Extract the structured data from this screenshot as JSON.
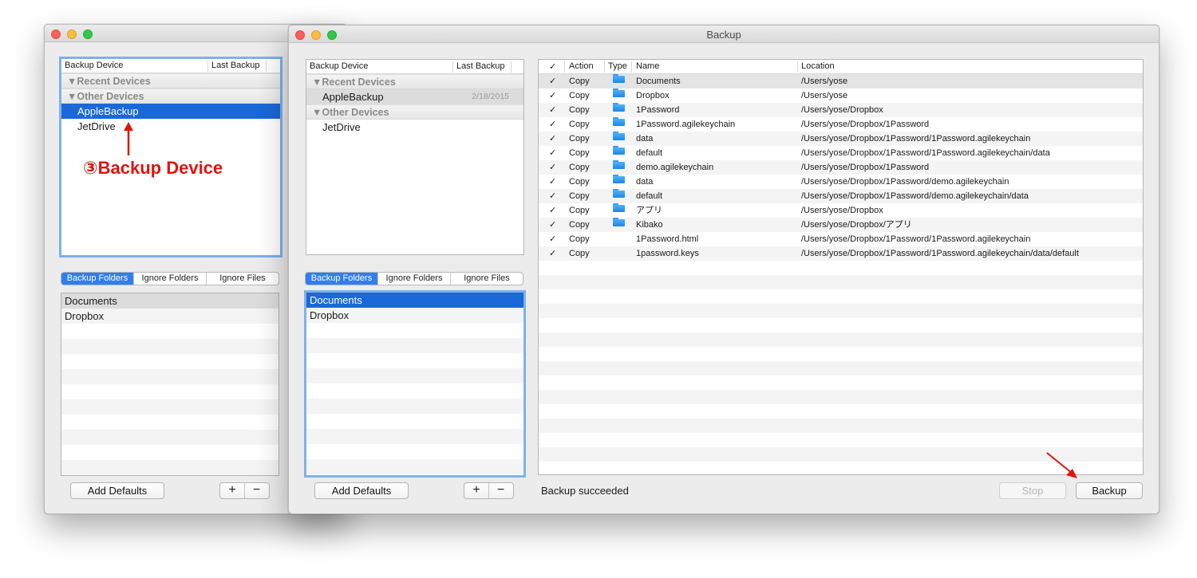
{
  "colors": {
    "accent": "#1b68d8",
    "annotation": "#e2130d"
  },
  "back_window": {
    "device_table": {
      "headers": [
        "Backup Device",
        "Last Backup"
      ],
      "groups": [
        {
          "label": "▼Recent Devices",
          "items": []
        },
        {
          "label": "▼Other Devices",
          "items": [
            {
              "name": "AppleBackup",
              "date": ""
            },
            {
              "name": "JetDrive",
              "date": ""
            }
          ]
        }
      ]
    },
    "tabs": [
      "Backup Folders",
      "Ignore Folders",
      "Ignore Files"
    ],
    "folders": [
      "Documents",
      "Dropbox"
    ],
    "add_defaults": "Add Defaults",
    "plus": "+",
    "minus": "−",
    "annotation": "③Backup Device"
  },
  "front_window": {
    "title": "Backup",
    "device_table": {
      "headers": [
        "Backup Device",
        "Last Backup"
      ],
      "groups": [
        {
          "label": "▼Recent Devices",
          "items": [
            {
              "name": "AppleBackup",
              "date": "2/18/2015"
            }
          ]
        },
        {
          "label": "▼Other Devices",
          "items": [
            {
              "name": "JetDrive",
              "date": ""
            }
          ]
        }
      ]
    },
    "tabs": [
      "Backup Folders",
      "Ignore Folders",
      "Ignore Files"
    ],
    "folders": [
      "Documents",
      "Dropbox"
    ],
    "add_defaults": "Add Defaults",
    "plus": "+",
    "minus": "−",
    "file_table": {
      "headers": {
        "check": "✓",
        "action": "Action",
        "type": "Type",
        "name": "Name",
        "location": "Location"
      },
      "rows": [
        {
          "check": "✓",
          "action": "Copy",
          "type": "folder-icon",
          "name": "Documents",
          "location": "/Users/yose"
        },
        {
          "check": "✓",
          "action": "Copy",
          "type": "folder-icon",
          "name": "Dropbox",
          "location": "/Users/yose"
        },
        {
          "check": "✓",
          "action": "Copy",
          "type": "folder-icon",
          "name": "1Password",
          "location": "/Users/yose/Dropbox"
        },
        {
          "check": "✓",
          "action": "Copy",
          "type": "folder-icon",
          "name": "1Password.agilekeychain",
          "location": "/Users/yose/Dropbox/1Password"
        },
        {
          "check": "✓",
          "action": "Copy",
          "type": "folder-icon",
          "name": "data",
          "location": "/Users/yose/Dropbox/1Password/1Password.agilekeychain"
        },
        {
          "check": "✓",
          "action": "Copy",
          "type": "folder-icon",
          "name": "default",
          "location": "/Users/yose/Dropbox/1Password/1Password.agilekeychain/data"
        },
        {
          "check": "✓",
          "action": "Copy",
          "type": "folder-icon",
          "name": "demo.agilekeychain",
          "location": "/Users/yose/Dropbox/1Password"
        },
        {
          "check": "✓",
          "action": "Copy",
          "type": "folder-icon",
          "name": "data",
          "location": "/Users/yose/Dropbox/1Password/demo.agilekeychain"
        },
        {
          "check": "✓",
          "action": "Copy",
          "type": "folder-icon",
          "name": "default",
          "location": "/Users/yose/Dropbox/1Password/demo.agilekeychain/data"
        },
        {
          "check": "✓",
          "action": "Copy",
          "type": "folder-icon",
          "name": "アプリ",
          "location": "/Users/yose/Dropbox"
        },
        {
          "check": "✓",
          "action": "Copy",
          "type": "folder-icon",
          "name": "Kibako",
          "location": "/Users/yose/Dropbox/アプリ"
        },
        {
          "check": "✓",
          "action": "Copy",
          "type": "",
          "name": "1Password.html",
          "location": "/Users/yose/Dropbox/1Password/1Password.agilekeychain"
        },
        {
          "check": "✓",
          "action": "Copy",
          "type": "",
          "name": "1password.keys",
          "location": "/Users/yose/Dropbox/1Password/1Password.agilekeychain/data/default"
        }
      ]
    },
    "status": "Backup succeeded",
    "stop_button": "Stop",
    "backup_button": "Backup"
  }
}
